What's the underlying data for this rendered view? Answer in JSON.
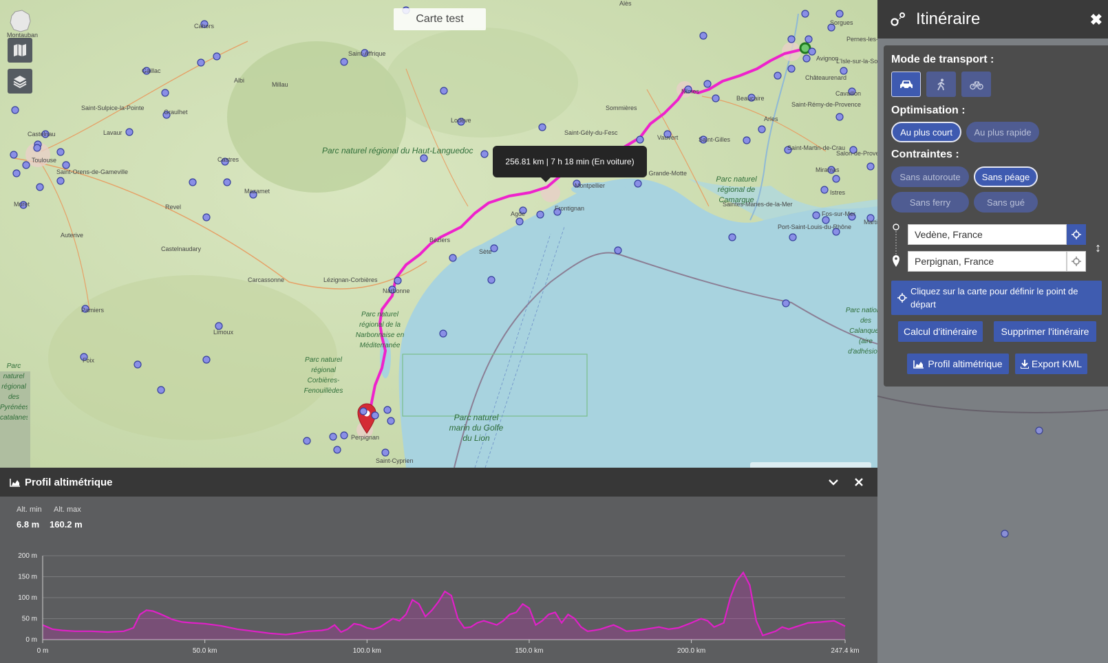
{
  "map": {
    "title": "Carte test",
    "route_tooltip": "256.81 km | 7 h 18 min (En voiture)",
    "route_color": "#ee22cc",
    "place_labels": [
      "Montauban",
      "Cahors",
      "Saint-Affrique",
      "Gaillac",
      "Albi",
      "Millau",
      "Lodève",
      "Saint-Sulpice-la-Pointe",
      "Graulhet",
      "Castelnau",
      "Toulouse",
      "Saint-Orens-de-Gameville",
      "Muret",
      "Lavaur",
      "Castres",
      "Mazamet",
      "Revel",
      "Auterive",
      "Castelnaudary",
      "Carcassonne",
      "Pamiers",
      "Lézignan-Corbières",
      "Narbonne",
      "Béziers",
      "Agde",
      "Sète",
      "Frontignan",
      "Montpellier",
      "Saint-Gély-du-Fesc",
      "Sommières",
      "Nîmes",
      "Beaucaire",
      "Vauvert",
      "Saint-Gilles",
      "La Grande-Motte",
      "Saintes-Maries-de-la-Mer",
      "Arles",
      "Saint-Martin-de-Crau",
      "Miramas",
      "Istres",
      "Salon-de-Provence",
      "Fos-sur-Mer",
      "Martigues",
      "Port-Saint-Louis-du-Rhône",
      "Châteaurenard",
      "Cavaillon",
      "Avignon",
      "Sorgues",
      "Pernes-les-Fontaines",
      "L'Isle-sur-la-Sorgue",
      "Saint-Rémy-de-Provence",
      "Perpignan",
      "Saint-Cyprien",
      "Limoux",
      "Foix",
      "Alès"
    ],
    "parks": [
      "Parc naturel régional du Haut-Languedoc",
      "Parc naturel régional de Camargue",
      "Parc naturel régional de la Narbonnaise en Méditerranée",
      "Parc naturel régional Corbières-Fenouillèdes",
      "Parc naturel marin du Golfe du Lion",
      "Parc national des Calanques (aire d'adhésion)",
      "Parc naturel régional des Pyrénées catalanes"
    ]
  },
  "itinerary": {
    "title": "Itinéraire",
    "transport_label": "Mode de transport :",
    "transport_modes": [
      "car",
      "walk",
      "bike"
    ],
    "optimisation_label": "Optimisation :",
    "optimisation": [
      {
        "label": "Au plus court",
        "active": true
      },
      {
        "label": "Au plus rapide",
        "active": false
      }
    ],
    "constraints_label": "Contraintes :",
    "constraints": [
      {
        "label": "Sans autoroute",
        "active": false
      },
      {
        "label": "Sans péage",
        "active": true
      },
      {
        "label": "Sans ferry",
        "active": false
      },
      {
        "label": "Sans gué",
        "active": false
      }
    ],
    "start": "Vedène, France",
    "end": "Perpignan, France",
    "info": "Cliquez sur la carte pour définir le point de départ",
    "calc_button": "Calcul d'itinéraire",
    "delete_button": "Supprimer l'itinéraire",
    "profile_button": "Profil altimétrique",
    "export_button": "Export KML",
    "accent": "#3e5ab0"
  },
  "profile": {
    "title": "Profil altimétrique",
    "alt_min_label": "Alt. min",
    "alt_max_label": "Alt. max",
    "alt_min": "6.8 m",
    "alt_max": "160.2 m"
  },
  "chart_data": {
    "type": "area",
    "color": "#e020c8",
    "xlim": [
      0,
      247.4
    ],
    "ylim": [
      0,
      200
    ],
    "x_ticks": [
      0,
      50,
      100,
      150,
      200,
      247.4
    ],
    "x_tick_labels": [
      "0 m",
      "50.0 km",
      "100.0 km",
      "150.0 km",
      "200.0 km",
      "247.4 km"
    ],
    "y_ticks": [
      0,
      50,
      100,
      150,
      200
    ],
    "y_tick_labels": [
      "0 m",
      "50 m",
      "100 m",
      "150 m",
      "200 m"
    ],
    "grid": true,
    "x": [
      0,
      3,
      6,
      10,
      15,
      20,
      25,
      28,
      30,
      32,
      34,
      36,
      38,
      40,
      43,
      46,
      50,
      55,
      60,
      65,
      70,
      75,
      78,
      82,
      86,
      88,
      90,
      92,
      94,
      96,
      98,
      100,
      102,
      104,
      106,
      108,
      110,
      112,
      114,
      116,
      118,
      120,
      122,
      124,
      126,
      128,
      130,
      132,
      134,
      136,
      138,
      140,
      142,
      144,
      146,
      148,
      150,
      152,
      154,
      156,
      158,
      160,
      162,
      164,
      166,
      168,
      170,
      172,
      174,
      176,
      178,
      180,
      183,
      186,
      190,
      193,
      196,
      200,
      203,
      205,
      207,
      210,
      212,
      214,
      216,
      218,
      220,
      222,
      224,
      226,
      228,
      230,
      232,
      234,
      236,
      240,
      244,
      247.4
    ],
    "y": [
      35,
      25,
      22,
      20,
      20,
      18,
      20,
      28,
      60,
      70,
      68,
      62,
      55,
      48,
      42,
      40,
      38,
      33,
      25,
      20,
      15,
      12,
      15,
      20,
      22,
      25,
      35,
      18,
      25,
      38,
      35,
      28,
      25,
      30,
      40,
      50,
      45,
      60,
      95,
      85,
      55,
      70,
      90,
      115,
      105,
      50,
      28,
      30,
      40,
      45,
      40,
      35,
      45,
      60,
      65,
      85,
      75,
      35,
      45,
      60,
      65,
      40,
      60,
      50,
      30,
      20,
      22,
      25,
      30,
      35,
      28,
      20,
      22,
      25,
      30,
      25,
      28,
      40,
      50,
      45,
      30,
      40,
      100,
      140,
      160,
      130,
      45,
      10,
      15,
      20,
      30,
      25,
      30,
      35,
      40,
      42,
      45,
      32
    ]
  }
}
